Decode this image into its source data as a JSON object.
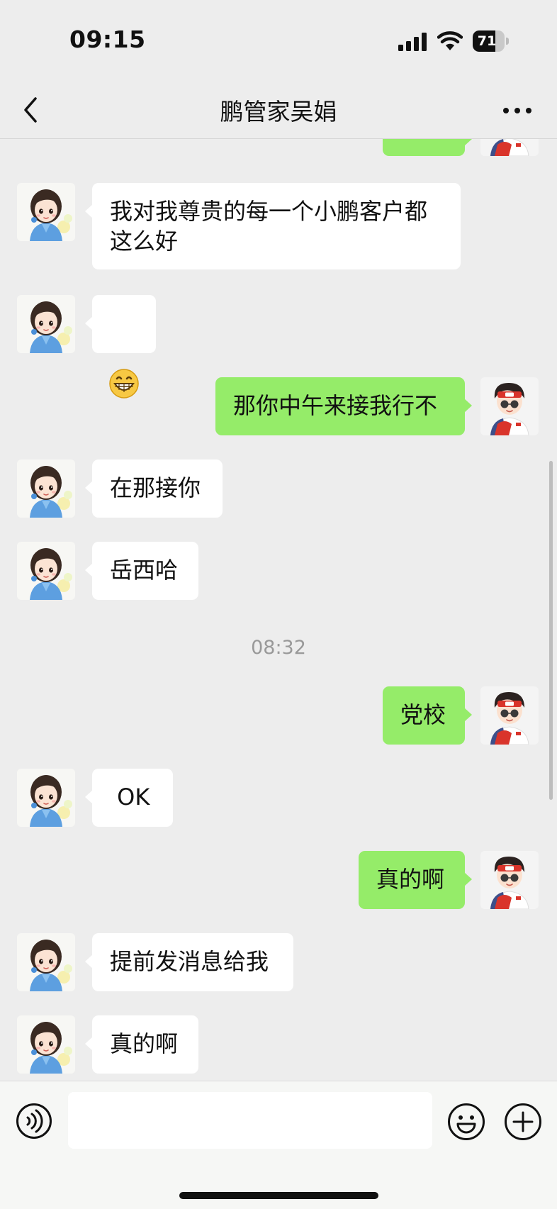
{
  "status_bar": {
    "time": "09:15",
    "battery": "71",
    "battery_level": 0.71
  },
  "header": {
    "title": "鹏管家吴娟"
  },
  "messages": [
    {
      "id": "m0",
      "from": "me",
      "text": "",
      "partial": true
    },
    {
      "id": "m1",
      "from": "contact",
      "text": "我对我尊贵的每一个小鹏客户都\n这么好"
    },
    {
      "id": "m2",
      "from": "contact",
      "text": "😁"
    },
    {
      "id": "m3",
      "from": "me",
      "text": "那你中午来接我行不"
    },
    {
      "id": "m4",
      "from": "contact",
      "text": "在那接你"
    },
    {
      "id": "m5",
      "from": "contact",
      "text": "岳西哈"
    },
    {
      "id": "t1",
      "type": "timestamp",
      "text": "08:32"
    },
    {
      "id": "m6",
      "from": "me",
      "text": "党校"
    },
    {
      "id": "m7",
      "from": "contact",
      "text": " OK"
    },
    {
      "id": "m8",
      "from": "me",
      "text": "真的啊"
    },
    {
      "id": "m9",
      "from": "contact",
      "text": "提前发消息给我"
    },
    {
      "id": "m10",
      "from": "contact",
      "text": "真的啊"
    }
  ],
  "input": {
    "value": "",
    "placeholder": ""
  },
  "colors": {
    "background": "#ededed",
    "outgoing_bubble": "#95ec69",
    "incoming_bubble": "#ffffff",
    "timestamp": "#999999"
  },
  "icons": {
    "back": "chevron-left-icon",
    "more": "more-dots-icon",
    "voice": "voice-icon",
    "emoji": "emoji-icon",
    "plus": "plus-icon"
  }
}
